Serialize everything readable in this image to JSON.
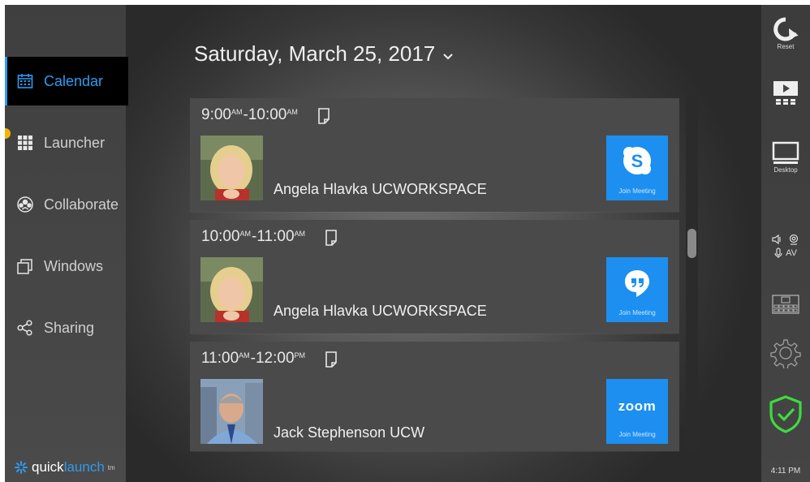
{
  "sidebar": {
    "items": [
      {
        "label": "Calendar",
        "icon": "calendar-icon",
        "active": true
      },
      {
        "label": "Launcher",
        "icon": "grid-icon",
        "active": false
      },
      {
        "label": "Collaborate",
        "icon": "collaborate-icon",
        "active": false
      },
      {
        "label": "Windows",
        "icon": "windows-icon",
        "active": false
      },
      {
        "label": "Sharing",
        "icon": "share-icon",
        "active": false
      }
    ],
    "brand": {
      "quick": "quick",
      "launch": "launch",
      "tm": "tm"
    }
  },
  "header": {
    "date": "Saturday, March 25, 2017",
    "chevron": "⌄"
  },
  "meetings": [
    {
      "start": "9:00",
      "start_ampm": "AM",
      "end": "10:00",
      "end_ampm": "AM",
      "name": "Angela Hlavka UCWORKSPACE",
      "service": "skype",
      "join_label": "Join Meeting"
    },
    {
      "start": "10:00",
      "start_ampm": "AM",
      "end": "11:00",
      "end_ampm": "AM",
      "name": "Angela Hlavka UCWORKSPACE",
      "service": "hangouts",
      "join_label": "Join Meeting"
    },
    {
      "start": "11:00",
      "start_ampm": "AM",
      "end": "12:00",
      "end_ampm": "PM",
      "name": "Jack Stephenson UCW",
      "service": "zoom",
      "service_text": "zoom",
      "join_label": "Join Meeting"
    }
  ],
  "rail": {
    "reset_label": "Reset",
    "desktop_label": "Desktop",
    "av_label": "AV",
    "time": "4:11 PM"
  },
  "colors": {
    "accent": "#2e9bf0",
    "join": "#1c8ff0",
    "shield": "#3ddc3d",
    "dot": "#f4b400"
  }
}
